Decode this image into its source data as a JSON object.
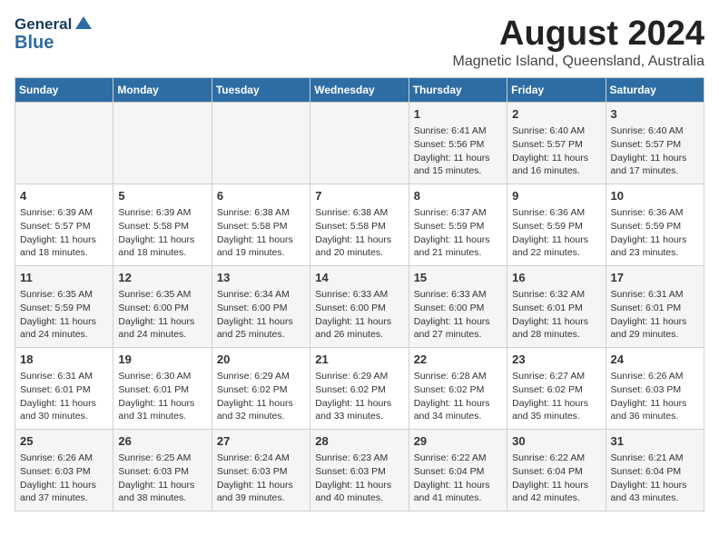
{
  "header": {
    "logo_line1": "General",
    "logo_line2": "Blue",
    "main_title": "August 2024",
    "subtitle": "Magnetic Island, Queensland, Australia"
  },
  "weekdays": [
    "Sunday",
    "Monday",
    "Tuesday",
    "Wednesday",
    "Thursday",
    "Friday",
    "Saturday"
  ],
  "weeks": [
    [
      {
        "day": "",
        "info": ""
      },
      {
        "day": "",
        "info": ""
      },
      {
        "day": "",
        "info": ""
      },
      {
        "day": "",
        "info": ""
      },
      {
        "day": "1",
        "info": "Sunrise: 6:41 AM\nSunset: 5:56 PM\nDaylight: 11 hours and 15 minutes."
      },
      {
        "day": "2",
        "info": "Sunrise: 6:40 AM\nSunset: 5:57 PM\nDaylight: 11 hours and 16 minutes."
      },
      {
        "day": "3",
        "info": "Sunrise: 6:40 AM\nSunset: 5:57 PM\nDaylight: 11 hours and 17 minutes."
      }
    ],
    [
      {
        "day": "4",
        "info": "Sunrise: 6:39 AM\nSunset: 5:57 PM\nDaylight: 11 hours and 18 minutes."
      },
      {
        "day": "5",
        "info": "Sunrise: 6:39 AM\nSunset: 5:58 PM\nDaylight: 11 hours and 18 minutes."
      },
      {
        "day": "6",
        "info": "Sunrise: 6:38 AM\nSunset: 5:58 PM\nDaylight: 11 hours and 19 minutes."
      },
      {
        "day": "7",
        "info": "Sunrise: 6:38 AM\nSunset: 5:58 PM\nDaylight: 11 hours and 20 minutes."
      },
      {
        "day": "8",
        "info": "Sunrise: 6:37 AM\nSunset: 5:59 PM\nDaylight: 11 hours and 21 minutes."
      },
      {
        "day": "9",
        "info": "Sunrise: 6:36 AM\nSunset: 5:59 PM\nDaylight: 11 hours and 22 minutes."
      },
      {
        "day": "10",
        "info": "Sunrise: 6:36 AM\nSunset: 5:59 PM\nDaylight: 11 hours and 23 minutes."
      }
    ],
    [
      {
        "day": "11",
        "info": "Sunrise: 6:35 AM\nSunset: 5:59 PM\nDaylight: 11 hours and 24 minutes."
      },
      {
        "day": "12",
        "info": "Sunrise: 6:35 AM\nSunset: 6:00 PM\nDaylight: 11 hours and 24 minutes."
      },
      {
        "day": "13",
        "info": "Sunrise: 6:34 AM\nSunset: 6:00 PM\nDaylight: 11 hours and 25 minutes."
      },
      {
        "day": "14",
        "info": "Sunrise: 6:33 AM\nSunset: 6:00 PM\nDaylight: 11 hours and 26 minutes."
      },
      {
        "day": "15",
        "info": "Sunrise: 6:33 AM\nSunset: 6:00 PM\nDaylight: 11 hours and 27 minutes."
      },
      {
        "day": "16",
        "info": "Sunrise: 6:32 AM\nSunset: 6:01 PM\nDaylight: 11 hours and 28 minutes."
      },
      {
        "day": "17",
        "info": "Sunrise: 6:31 AM\nSunset: 6:01 PM\nDaylight: 11 hours and 29 minutes."
      }
    ],
    [
      {
        "day": "18",
        "info": "Sunrise: 6:31 AM\nSunset: 6:01 PM\nDaylight: 11 hours and 30 minutes."
      },
      {
        "day": "19",
        "info": "Sunrise: 6:30 AM\nSunset: 6:01 PM\nDaylight: 11 hours and 31 minutes."
      },
      {
        "day": "20",
        "info": "Sunrise: 6:29 AM\nSunset: 6:02 PM\nDaylight: 11 hours and 32 minutes."
      },
      {
        "day": "21",
        "info": "Sunrise: 6:29 AM\nSunset: 6:02 PM\nDaylight: 11 hours and 33 minutes."
      },
      {
        "day": "22",
        "info": "Sunrise: 6:28 AM\nSunset: 6:02 PM\nDaylight: 11 hours and 34 minutes."
      },
      {
        "day": "23",
        "info": "Sunrise: 6:27 AM\nSunset: 6:02 PM\nDaylight: 11 hours and 35 minutes."
      },
      {
        "day": "24",
        "info": "Sunrise: 6:26 AM\nSunset: 6:03 PM\nDaylight: 11 hours and 36 minutes."
      }
    ],
    [
      {
        "day": "25",
        "info": "Sunrise: 6:26 AM\nSunset: 6:03 PM\nDaylight: 11 hours and 37 minutes."
      },
      {
        "day": "26",
        "info": "Sunrise: 6:25 AM\nSunset: 6:03 PM\nDaylight: 11 hours and 38 minutes."
      },
      {
        "day": "27",
        "info": "Sunrise: 6:24 AM\nSunset: 6:03 PM\nDaylight: 11 hours and 39 minutes."
      },
      {
        "day": "28",
        "info": "Sunrise: 6:23 AM\nSunset: 6:03 PM\nDaylight: 11 hours and 40 minutes."
      },
      {
        "day": "29",
        "info": "Sunrise: 6:22 AM\nSunset: 6:04 PM\nDaylight: 11 hours and 41 minutes."
      },
      {
        "day": "30",
        "info": "Sunrise: 6:22 AM\nSunset: 6:04 PM\nDaylight: 11 hours and 42 minutes."
      },
      {
        "day": "31",
        "info": "Sunrise: 6:21 AM\nSunset: 6:04 PM\nDaylight: 11 hours and 43 minutes."
      }
    ]
  ]
}
